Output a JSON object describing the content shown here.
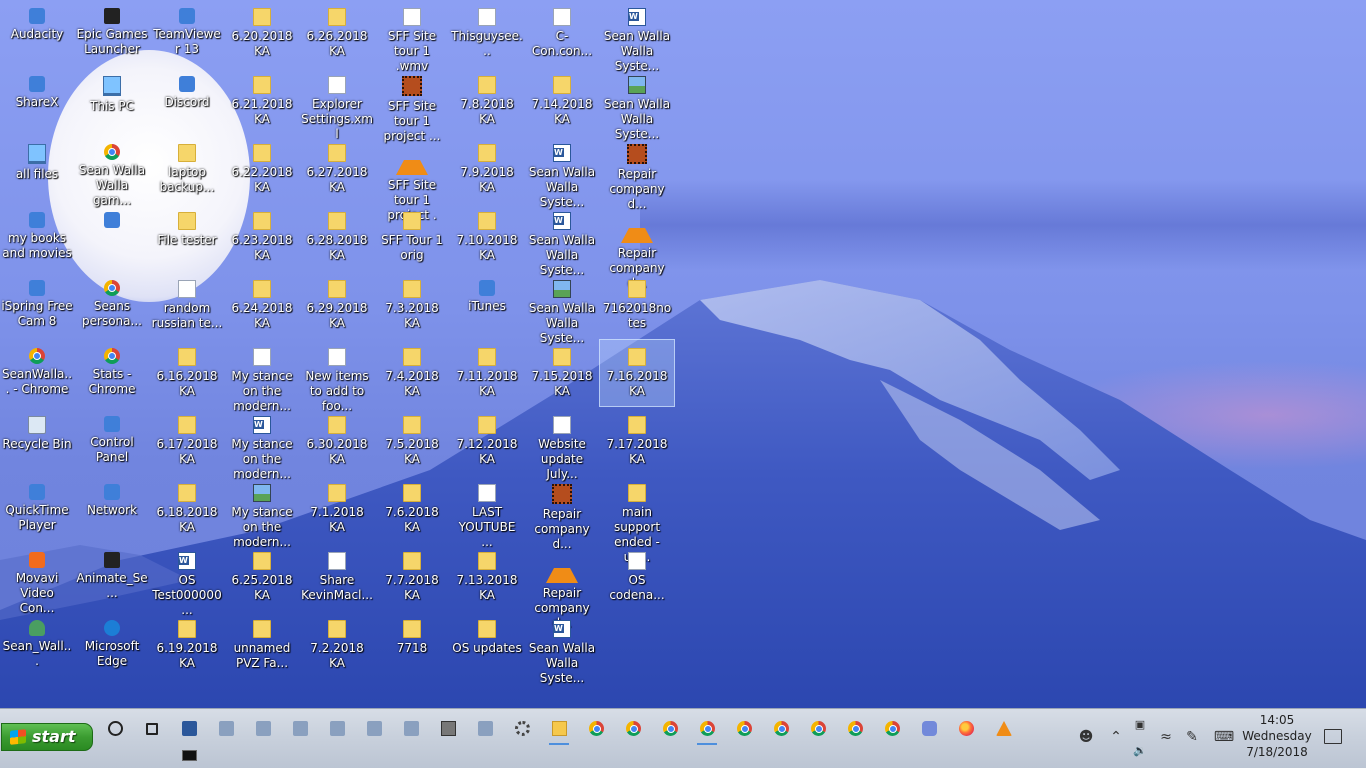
{
  "desktop": {
    "icons": [
      {
        "label": "Audacity",
        "icon": "audacity-icon"
      },
      {
        "label": "ShareX",
        "icon": "sharex-icon"
      },
      {
        "label": "all files",
        "icon": "monitor-icon"
      },
      {
        "label": "my books and movies",
        "icon": "library-icon"
      },
      {
        "label": "iSpring Free Cam 8",
        "icon": "ispring-icon"
      },
      {
        "label": "SeanWalla... - Chrome",
        "icon": "chrome-icon"
      },
      {
        "label": "Recycle Bin",
        "icon": "recycle-bin-icon"
      },
      {
        "label": "QuickTime Player",
        "icon": "quicktime-icon"
      },
      {
        "label": "Movavi Video Con...",
        "icon": "movavi-icon"
      },
      {
        "label": "Sean_Wall...",
        "icon": "user-shortcut-icon"
      },
      {
        "label": "Epic Games Launcher",
        "icon": "epic-games-icon"
      },
      {
        "label": "This PC",
        "icon": "computer-icon"
      },
      {
        "label": "Sean Walla Walla gam...",
        "icon": "chrome-icon"
      },
      {
        "label": "",
        "icon": "generic-app-icon"
      },
      {
        "label": "Seans persona...",
        "icon": "chrome-icon"
      },
      {
        "label": "Stats - Chrome",
        "icon": "chrome-icon"
      },
      {
        "label": "Control Panel",
        "icon": "control-panel-icon"
      },
      {
        "label": "Network",
        "icon": "network-icon"
      },
      {
        "label": "Animate_Se...",
        "icon": "animate-icon"
      },
      {
        "label": "Microsoft Edge",
        "icon": "edge-icon"
      },
      {
        "label": "TeamViewer 13",
        "icon": "teamviewer-icon"
      },
      {
        "label": "Discord",
        "icon": "discord-icon"
      },
      {
        "label": "laptop backup...",
        "icon": "folder-icon"
      },
      {
        "label": "File tester",
        "icon": "folder-icon"
      },
      {
        "label": "random russian te...",
        "icon": "text-file-icon"
      },
      {
        "label": "6.16.2018 KA",
        "icon": "folder-icon"
      },
      {
        "label": "6.17.2018 KA",
        "icon": "folder-icon"
      },
      {
        "label": "6.18.2018 KA",
        "icon": "folder-icon"
      },
      {
        "label": "OS Test000000...",
        "icon": "word-doc-icon"
      },
      {
        "label": "6.19.2018 KA",
        "icon": "folder-icon"
      },
      {
        "label": "6.20.2018 KA",
        "icon": "folder-icon"
      },
      {
        "label": "6.21.2018 KA",
        "icon": "folder-icon"
      },
      {
        "label": "6.22.2018 KA",
        "icon": "folder-icon"
      },
      {
        "label": "6.23.2018 KA",
        "icon": "folder-icon"
      },
      {
        "label": "6.24.2018 KA",
        "icon": "folder-icon"
      },
      {
        "label": "My stance on the modern...",
        "icon": "text-file-icon"
      },
      {
        "label": "My stance on the modern...",
        "icon": "word-doc-icon"
      },
      {
        "label": "My stance on the modern...",
        "icon": "image-file-icon"
      },
      {
        "label": "6.25.2018 KA",
        "icon": "folder-icon"
      },
      {
        "label": "unnamed PVZ Fa...",
        "icon": "folder-icon"
      },
      {
        "label": "6.26.2018 KA",
        "icon": "folder-icon"
      },
      {
        "label": "Explorer Settings.xml",
        "icon": "xml-file-icon"
      },
      {
        "label": "6.27.2018 KA",
        "icon": "folder-icon"
      },
      {
        "label": "6.28.2018 KA",
        "icon": "folder-icon"
      },
      {
        "label": "6.29.2018 KA",
        "icon": "folder-icon"
      },
      {
        "label": "New items to add to foo...",
        "icon": "text-file-icon"
      },
      {
        "label": "6.30.2018 KA",
        "icon": "folder-icon"
      },
      {
        "label": "7.1.2018 KA",
        "icon": "folder-icon"
      },
      {
        "label": "Share KevinMacl...",
        "icon": "text-file-icon"
      },
      {
        "label": "7.2.2018 KA",
        "icon": "folder-icon"
      },
      {
        "label": "SFF Site tour 1 .wmv",
        "icon": "video-file-icon"
      },
      {
        "label": "SFF Site tour 1 project ...",
        "icon": "film-file-icon"
      },
      {
        "label": "SFF Site tour 1 project .",
        "icon": "vlc-icon"
      },
      {
        "label": "SFF Tour 1 orig",
        "icon": "folder-icon"
      },
      {
        "label": "7.3.2018 KA",
        "icon": "folder-icon"
      },
      {
        "label": "7.4.2018 KA",
        "icon": "folder-icon"
      },
      {
        "label": "7.5.2018 KA",
        "icon": "folder-icon"
      },
      {
        "label": "7.6.2018 KA",
        "icon": "folder-icon"
      },
      {
        "label": "7.7.2018 KA",
        "icon": "folder-icon"
      },
      {
        "label": "7718",
        "icon": "folder-icon"
      },
      {
        "label": "Thisguysee...",
        "icon": "text-file-icon"
      },
      {
        "label": "7.8.2018 KA",
        "icon": "folder-icon"
      },
      {
        "label": "7.9.2018 KA",
        "icon": "folder-icon"
      },
      {
        "label": "7.10.2018 KA",
        "icon": "folder-icon"
      },
      {
        "label": "iTunes",
        "icon": "itunes-icon"
      },
      {
        "label": "7.11.2018 KA",
        "icon": "folder-icon"
      },
      {
        "label": "7.12.2018 KA",
        "icon": "folder-icon"
      },
      {
        "label": "LAST YOUTUBE ...",
        "icon": "text-file-icon"
      },
      {
        "label": "7.13.2018 KA",
        "icon": "folder-icon"
      },
      {
        "label": "OS updates",
        "icon": "folder-icon"
      },
      {
        "label": "C-Con.con...",
        "icon": "text-file-icon"
      },
      {
        "label": "7.14.2018 KA",
        "icon": "folder-icon"
      },
      {
        "label": "Sean Walla Walla Syste...",
        "icon": "word-doc-icon"
      },
      {
        "label": "Sean Walla Walla Syste...",
        "icon": "word-doc-icon"
      },
      {
        "label": "Sean Walla Walla Syste...",
        "icon": "image-file-icon"
      },
      {
        "label": "7.15.2018 KA",
        "icon": "folder-icon"
      },
      {
        "label": "Website update July...",
        "icon": "text-file-icon"
      },
      {
        "label": "Repair company d...",
        "icon": "film-file-icon"
      },
      {
        "label": "Repair company d...",
        "icon": "vlc-icon"
      },
      {
        "label": "Sean Walla Walla Syste...",
        "icon": "word-doc-icon"
      },
      {
        "label": "Sean Walla Walla Syste...",
        "icon": "word-doc-icon"
      },
      {
        "label": "Sean Walla Walla Syste...",
        "icon": "image-file-icon"
      },
      {
        "label": "Repair company d...",
        "icon": "film-file-icon"
      },
      {
        "label": "Repair company d...",
        "icon": "vlc-icon"
      },
      {
        "label": "7162018notes",
        "icon": "folder-icon"
      },
      {
        "label": "7.16.2018 KA",
        "icon": "folder-open-icon",
        "selected": true
      },
      {
        "label": "7.17.2018 KA",
        "icon": "folder-icon"
      },
      {
        "label": "main support ended - up...",
        "icon": "folder-icon"
      },
      {
        "label": "OS codena...",
        "icon": "text-file-icon"
      }
    ]
  },
  "taskbar": {
    "start_label": "start",
    "pinned": [
      {
        "name": "cortana-icon",
        "kind": "circle"
      },
      {
        "name": "task-view-icon",
        "kind": "taskview"
      },
      {
        "name": "word-icon",
        "kind": "word"
      },
      {
        "name": "app-icon",
        "kind": "generic"
      },
      {
        "name": "paint-icon",
        "kind": "generic"
      },
      {
        "name": "notepad-icon",
        "kind": "generic"
      },
      {
        "name": "snipping-icon",
        "kind": "generic"
      },
      {
        "name": "photos-icon",
        "kind": "generic"
      },
      {
        "name": "video-editor-icon",
        "kind": "generic"
      },
      {
        "name": "calculator-icon",
        "kind": "calc"
      },
      {
        "name": "document-icon",
        "kind": "generic"
      },
      {
        "name": "settings-icon",
        "kind": "gear"
      },
      {
        "name": "file-explorer-icon",
        "kind": "explorer",
        "active": true
      },
      {
        "name": "chrome-icon",
        "kind": "chrome"
      },
      {
        "name": "chrome-icon",
        "kind": "chrome"
      },
      {
        "name": "chrome-icon",
        "kind": "chrome"
      },
      {
        "name": "chrome-icon",
        "kind": "chrome",
        "active": true
      },
      {
        "name": "chrome-icon",
        "kind": "chrome"
      },
      {
        "name": "chrome-icon",
        "kind": "chrome"
      },
      {
        "name": "chrome-icon",
        "kind": "chrome"
      },
      {
        "name": "chrome-icon",
        "kind": "chrome"
      },
      {
        "name": "chrome-icon",
        "kind": "chrome"
      },
      {
        "name": "discord-icon",
        "kind": "discord"
      },
      {
        "name": "firefox-icon",
        "kind": "firefox"
      },
      {
        "name": "vlc-icon",
        "kind": "vlc"
      }
    ],
    "tray": {
      "time": "14:05",
      "day": "Wednesday",
      "date": "7/18/2018"
    }
  }
}
